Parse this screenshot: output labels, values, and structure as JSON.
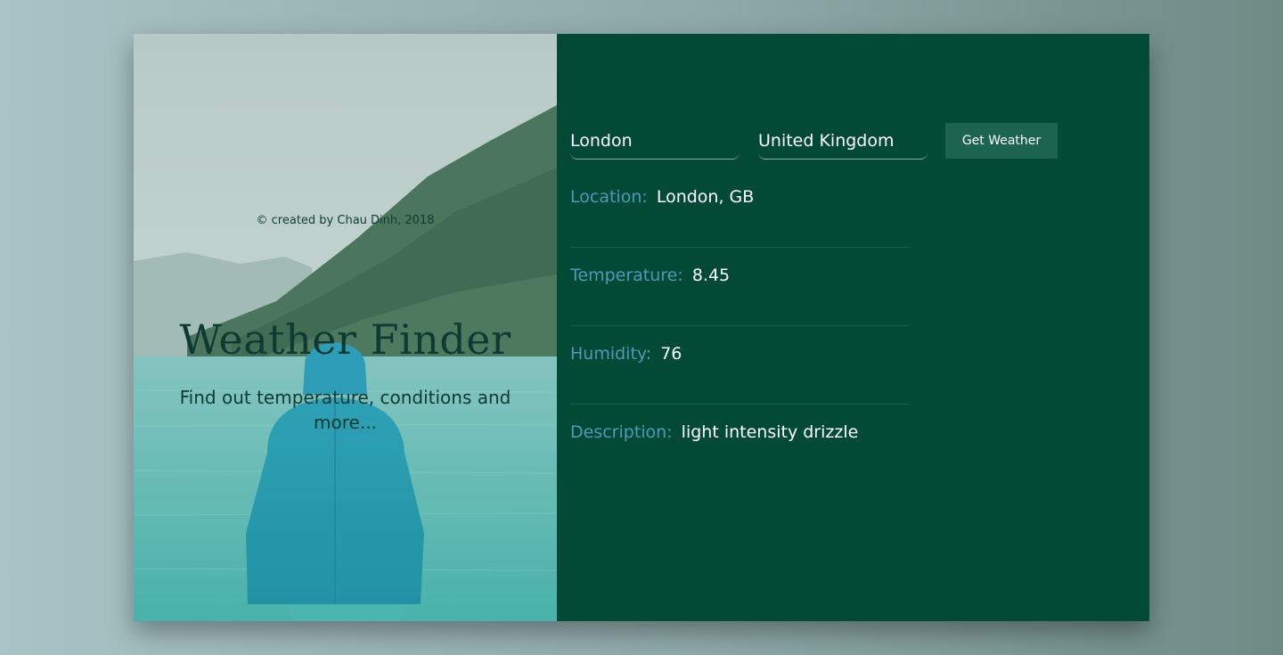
{
  "hero": {
    "credit": "© created by Chau Dinh, 2018",
    "title": "Weather Finder",
    "subtitle": "Find out temperature, conditions and more..."
  },
  "form": {
    "city_value": "London",
    "country_value": "United Kingdom",
    "submit_label": "Get Weather"
  },
  "results": [
    {
      "label": "Location:",
      "value": "London, GB"
    },
    {
      "label": "Temperature:",
      "value": "8.45"
    },
    {
      "label": "Humidity:",
      "value": "76"
    },
    {
      "label": "Description:",
      "value": "light intensity drizzle"
    }
  ],
  "colors": {
    "panel": "#024a36",
    "label": "#4d9ab8",
    "button": "#1c6450",
    "accent_teal": "#2aa7a4"
  }
}
